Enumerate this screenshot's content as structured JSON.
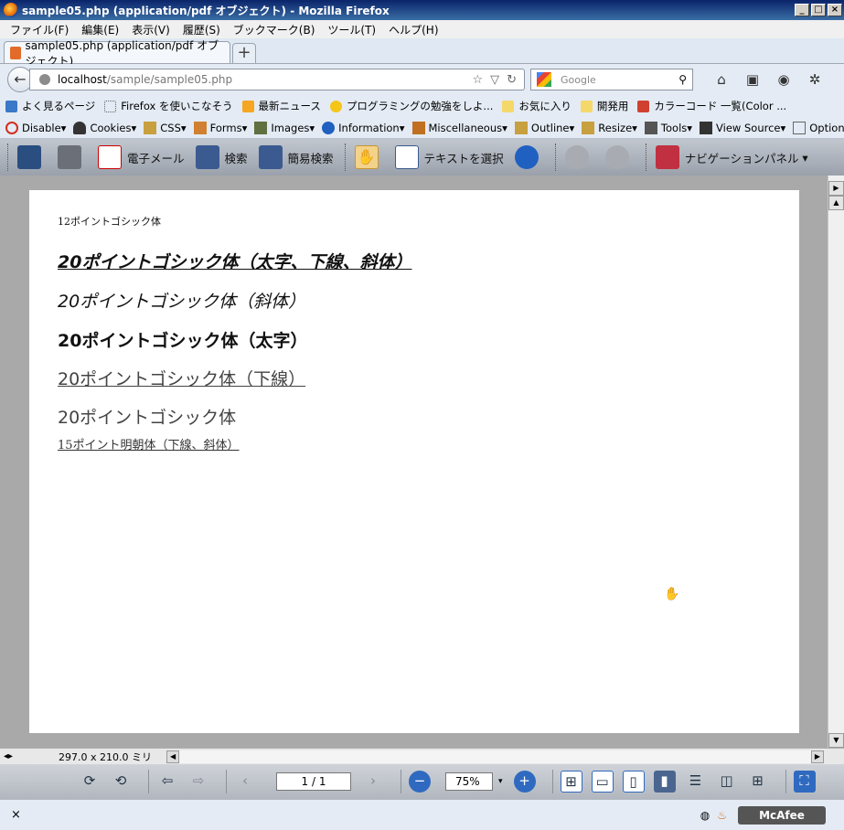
{
  "window": {
    "title": "sample05.php (application/pdf オブジェクト) - Mozilla Firefox",
    "controls": [
      "_",
      "□",
      "×"
    ]
  },
  "menu": [
    "ファイル(F)",
    "編集(E)",
    "表示(V)",
    "履歴(S)",
    "ブックマーク(B)",
    "ツール(T)",
    "ヘルプ(H)"
  ],
  "tab": {
    "label": "sample05.php (application/pdf オブジェクト)",
    "new_tab": "+"
  },
  "nav": {
    "back": "←",
    "url_host": "localhost",
    "url_path": "/sample/sample05.php",
    "search_placeholder": "Google"
  },
  "bookmarks": [
    {
      "label": "よく見るページ",
      "color": "#3a78c8"
    },
    {
      "label": "Firefox を使いこなそう",
      "color": "#ffffff"
    },
    {
      "label": "最新ニュース",
      "color": "#f5a623"
    },
    {
      "label": "プログラミングの勉強をしよ...",
      "color": "#f5c518"
    },
    {
      "label": "お気に入り",
      "color": "#f5d86a"
    },
    {
      "label": "開発用",
      "color": "#f5d86a"
    },
    {
      "label": "カラーコード 一覧(Color ...",
      "color": "#d04030"
    }
  ],
  "devtools": [
    {
      "label": "Disable▾",
      "color": "#d03020"
    },
    {
      "label": "Cookies▾",
      "color": "#333333"
    },
    {
      "label": "CSS▾",
      "color": "#c8a040"
    },
    {
      "label": "Forms▾",
      "color": "#d08030"
    },
    {
      "label": "Images▾",
      "color": "#607040"
    },
    {
      "label": "Information▾",
      "color": "#2060c0"
    },
    {
      "label": "Miscellaneous▾",
      "color": "#c07020"
    },
    {
      "label": "Outline▾",
      "color": "#c8a040"
    },
    {
      "label": "Resize▾",
      "color": "#c8a040"
    },
    {
      "label": "Tools▾",
      "color": "#555555"
    },
    {
      "label": "View Source▾",
      "color": "#333333"
    },
    {
      "label": "Options▾",
      "color": "#666666"
    }
  ],
  "pdf_toolbar": {
    "email": "電子メール",
    "search": "検索",
    "quick_search": "簡易検索",
    "select_text": "テキストを選択",
    "nav_panel": "ナビゲーションパネル"
  },
  "pdf_page": {
    "line1": "12ポイントゴシック体",
    "line2": "20ポイントゴシック体（太字、下線、斜体）",
    "line3": "20ポイントゴシック体（斜体）",
    "line4": "20ポイントゴシック体（太字）",
    "line5": "20ポイントゴシック体（下線）",
    "line6": "20ポイントゴシック体",
    "line7": "15ポイント明朝体（下線、斜体）"
  },
  "status": {
    "page_size": "297.0 x 210.0 ミリ",
    "page_indicator": "1 / 1",
    "zoom": "75%",
    "close": "×",
    "mcafee": "McAfee"
  }
}
